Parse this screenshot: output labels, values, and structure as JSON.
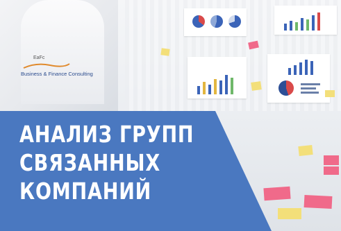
{
  "brand": {
    "mark": "ЕаFс",
    "name": "Business & Finance Consulting"
  },
  "title": {
    "line1": "АНАЛИЗ ГРУПП",
    "line2": "СВЯЗАННЫХ",
    "line3": "КОМПАНИЙ"
  },
  "colors": {
    "title_block": "#4a78c0",
    "title_text": "#ffffff",
    "brand_text": "#2a4b8d"
  }
}
